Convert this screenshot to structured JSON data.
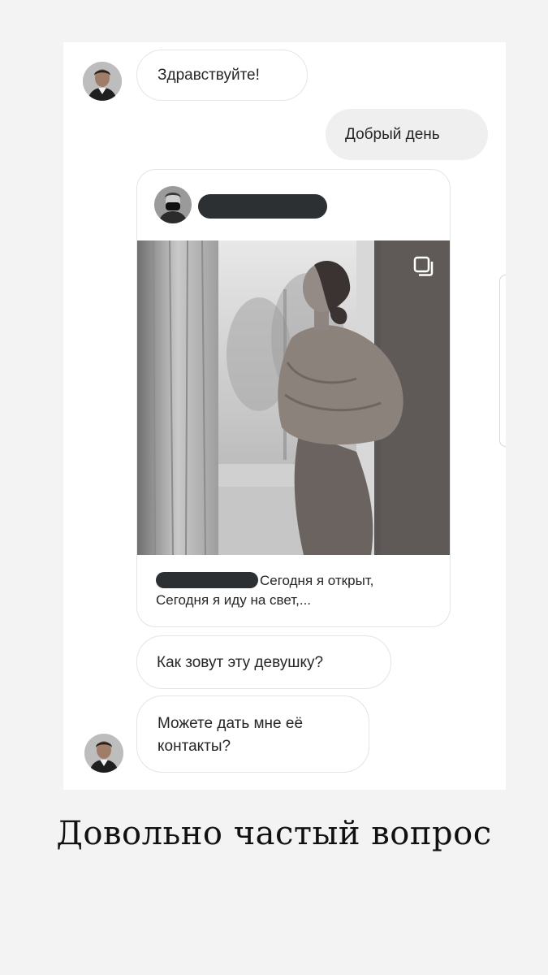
{
  "messages": {
    "greeting_in": "Здравствуйте!",
    "greeting_out": "Добрый день",
    "question_name": "Как зовут эту девушку?",
    "question_contacts_line1": "Можете дать мне её",
    "question_contacts_line2": "контакты?"
  },
  "shared_post": {
    "caption_line1": "Сегодня я открыт,",
    "caption_line2": "Сегодня я иду на свет,..."
  },
  "footer": {
    "title": "Довольно частый вопрос"
  },
  "colors": {
    "background": "#f3f3f3",
    "card": "#ffffff",
    "outgoing_bubble": "#efefef",
    "redaction": "#2d3033"
  },
  "icons": {
    "carousel": "multiple-images-icon"
  }
}
